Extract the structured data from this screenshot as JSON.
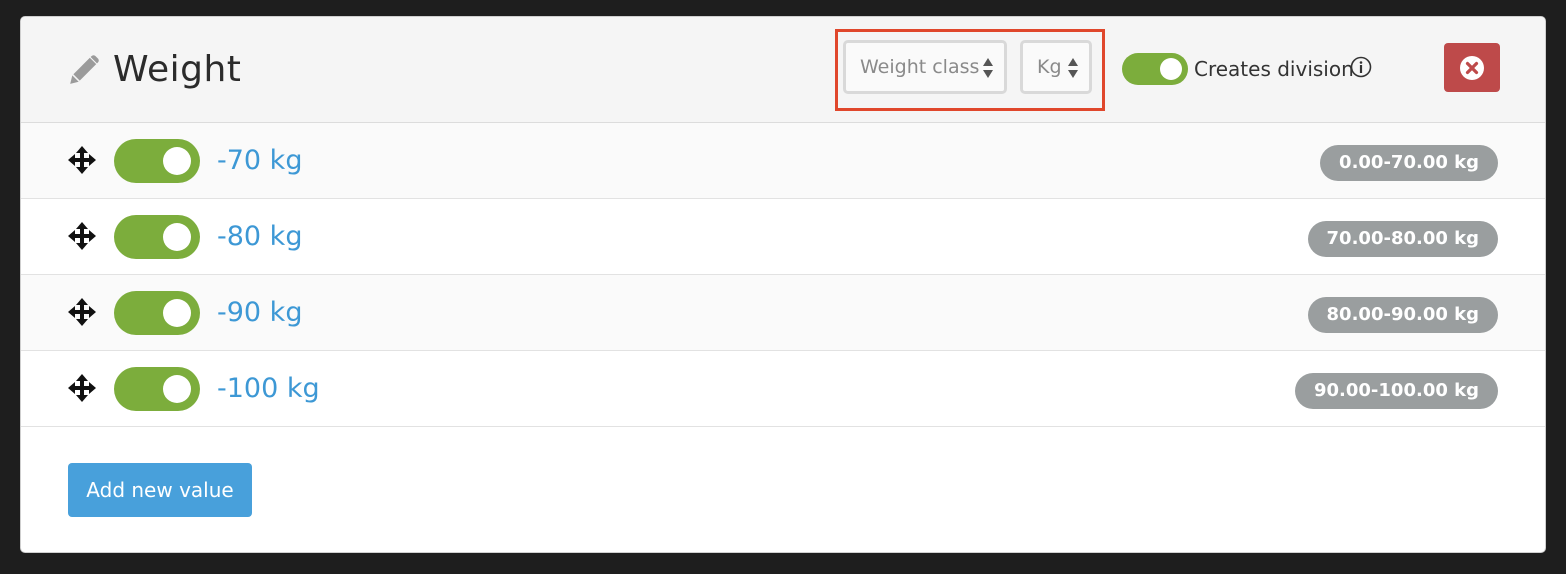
{
  "header": {
    "title": "Weight",
    "select_type": "Weight class",
    "select_unit": "Kg",
    "division_label": "Creates division"
  },
  "rows": [
    {
      "label": "-70 kg",
      "range": "0.00-70.00 kg"
    },
    {
      "label": "-80 kg",
      "range": "70.00-80.00 kg"
    },
    {
      "label": "-90 kg",
      "range": "80.00-90.00 kg"
    },
    {
      "label": "-100 kg",
      "range": "90.00-100.00 kg"
    }
  ],
  "add_button": "Add new value",
  "colors": {
    "toggle_on": "#7cad3c",
    "link": "#3d98d5",
    "danger": "#be4a4a",
    "primary": "#48a0db",
    "badge": "#9a9e9f",
    "highlight": "#e0472c"
  }
}
